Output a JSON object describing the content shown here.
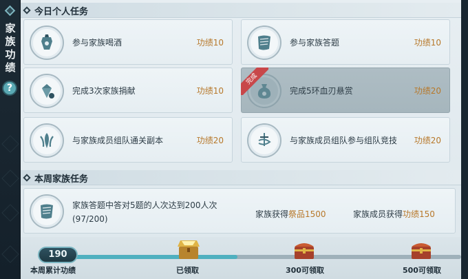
{
  "sidebar": {
    "title": "家族功绩",
    "help": "?"
  },
  "daily": {
    "header": "今日个人任务",
    "tasks": [
      {
        "label": "参与家族喝酒",
        "reward": "功绩10",
        "icon": "wine-jar-icon",
        "done": false
      },
      {
        "label": "参与家族答题",
        "reward": "功绩10",
        "icon": "scroll-icon",
        "done": false
      },
      {
        "label": "完成3次家族捐献",
        "reward": "功绩10",
        "icon": "gem-donation-icon",
        "done": false
      },
      {
        "label": "完成5环血刃悬赏",
        "reward": "功绩20",
        "icon": "money-bag-icon",
        "done": true,
        "badge": "完成"
      },
      {
        "label": "与家族成员组队通关副本",
        "reward": "功绩20",
        "icon": "team-dungeon-icon",
        "done": false
      },
      {
        "label": "与家族成员组队参与组队竞技",
        "reward": "功绩20",
        "icon": "sword-arena-icon",
        "done": false
      }
    ]
  },
  "weekly": {
    "header": "本周家族任务",
    "task": {
      "line1": "家族答题中答对5题的人次达到200人次",
      "line2": "(97/200)",
      "icon": "scroll-icon",
      "reward1_prefix": "家族获得",
      "reward1_value": "祭品1500",
      "reward2_prefix": "家族成员获得",
      "reward2_value": "功绩150"
    }
  },
  "progress": {
    "score": "190",
    "score_label": "本周累计功绩",
    "fill_fraction": 0.44,
    "chests": [
      {
        "label": "已领取",
        "state": "opened"
      },
      {
        "label": "300可领取",
        "state": "closed"
      },
      {
        "label": "500可领取",
        "state": "closed"
      }
    ]
  },
  "colors": {
    "reward": "#b7782a",
    "accent": "#4fb0bf",
    "done_ribbon": "#c8474a"
  }
}
